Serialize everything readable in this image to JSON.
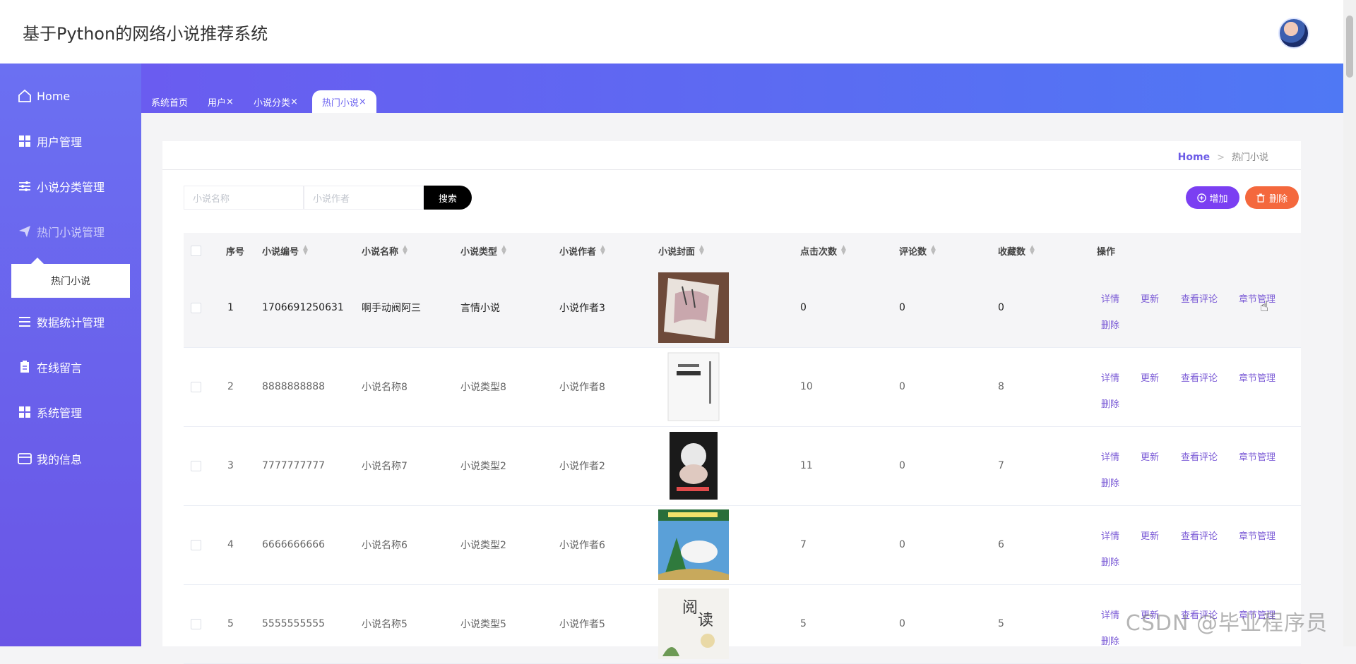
{
  "app": {
    "title": "基于Python的网络小说推荐系统"
  },
  "sidebar": {
    "items": [
      {
        "label": "Home",
        "icon": "home-icon"
      },
      {
        "label": "用户管理",
        "icon": "grid-icon"
      },
      {
        "label": "小说分类管理",
        "icon": "sliders-icon"
      },
      {
        "label": "热门小说管理",
        "icon": "send-icon"
      },
      {
        "label": "数据统计管理",
        "icon": "list-icon"
      },
      {
        "label": "在线留言",
        "icon": "clipboard-icon"
      },
      {
        "label": "系统管理",
        "icon": "grid-icon"
      },
      {
        "label": "我的信息",
        "icon": "card-icon"
      }
    ],
    "submenu": "热门小说"
  },
  "tabs": [
    {
      "label": "系统首页"
    },
    {
      "label": "用户"
    },
    {
      "label": "小说分类"
    },
    {
      "label": "热门小说"
    }
  ],
  "tab_close": "×",
  "breadcrumb": {
    "home": "Home",
    "sep": ">",
    "current": "热门小说"
  },
  "search": {
    "name_placeholder": "小说名称",
    "author_placeholder": "小说作者",
    "button": "搜索"
  },
  "toolbar": {
    "add": "增加",
    "delete": "删除"
  },
  "table": {
    "columns": [
      "序号",
      "小说编号",
      "小说名称",
      "小说类型",
      "小说作者",
      "小说封面",
      "点击次数",
      "评论数",
      "收藏数",
      "操作"
    ],
    "rows": [
      {
        "index": "1",
        "code": "1706691250631",
        "name": "啊手动阀阿三",
        "type": "言情小说",
        "author": "小说作者3",
        "clicks": "0",
        "comments": "0",
        "favorites": "0"
      },
      {
        "index": "2",
        "code": "8888888888",
        "name": "小说名称8",
        "type": "小说类型8",
        "author": "小说作者8",
        "clicks": "10",
        "comments": "0",
        "favorites": "8"
      },
      {
        "index": "3",
        "code": "7777777777",
        "name": "小说名称7",
        "type": "小说类型2",
        "author": "小说作者2",
        "clicks": "11",
        "comments": "0",
        "favorites": "7"
      },
      {
        "index": "4",
        "code": "6666666666",
        "name": "小说名称6",
        "type": "小说类型2",
        "author": "小说作者6",
        "clicks": "7",
        "comments": "0",
        "favorites": "6"
      },
      {
        "index": "5",
        "code": "5555555555",
        "name": "小说名称5",
        "type": "小说类型5",
        "author": "小说作者5",
        "clicks": "5",
        "comments": "0",
        "favorites": "5"
      }
    ],
    "actions": {
      "detail": "详情",
      "update": "更新",
      "comments": "查看评论",
      "chapters": "章节管理",
      "delete": "删除"
    }
  },
  "watermark": "CSDN @毕业程序员",
  "colors": {
    "accent": "#6c5ce7",
    "add": "#7b3ff2",
    "delete": "#f4683d",
    "sidebar": "#6a5cf0"
  }
}
